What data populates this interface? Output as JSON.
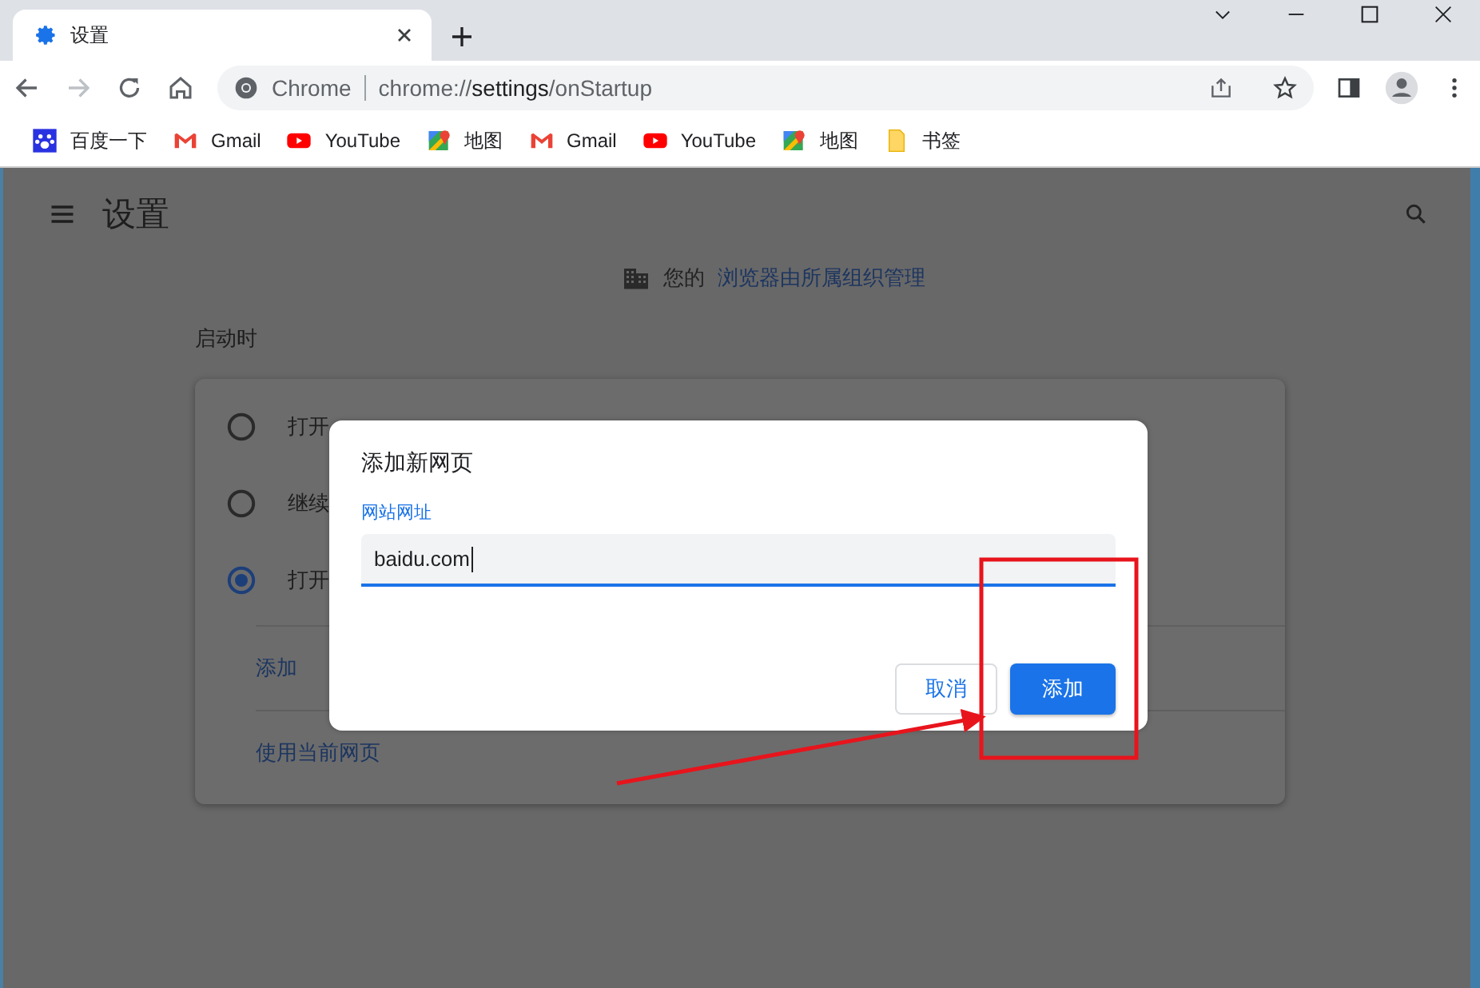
{
  "tabs": [
    {
      "title": "设置",
      "selected": true
    }
  ],
  "address_bar": {
    "site_label": "Chrome",
    "url_scheme": "chrome://",
    "url_host": "settings",
    "url_path": "/onStartup"
  },
  "bookmarks": [
    {
      "label": "百度一下",
      "kind": "baidu"
    },
    {
      "label": "Gmail",
      "kind": "gmail"
    },
    {
      "label": "YouTube",
      "kind": "youtube"
    },
    {
      "label": "地图",
      "kind": "maps"
    },
    {
      "label": "Gmail",
      "kind": "gmail"
    },
    {
      "label": "YouTube",
      "kind": "youtube"
    },
    {
      "label": "地图",
      "kind": "maps"
    },
    {
      "label": "书签",
      "kind": "folder"
    }
  ],
  "settings": {
    "title": "设置",
    "managed_notice_prefix": "您的",
    "managed_notice_link": "浏览器由所属组织管理",
    "section_title": "启动时",
    "startup_options": [
      {
        "label": "打开",
        "selected": false
      },
      {
        "label": "继续",
        "selected": false
      },
      {
        "label": "打开",
        "selected": true
      }
    ],
    "actions": [
      "添加",
      "使用当前网页"
    ]
  },
  "dialog": {
    "title": "添加新网页",
    "field_label": "网站网址",
    "field_value": "baidu.com",
    "buttons": [
      {
        "label": "取消",
        "kind": "secondary"
      },
      {
        "label": "添加",
        "kind": "primary"
      }
    ]
  }
}
